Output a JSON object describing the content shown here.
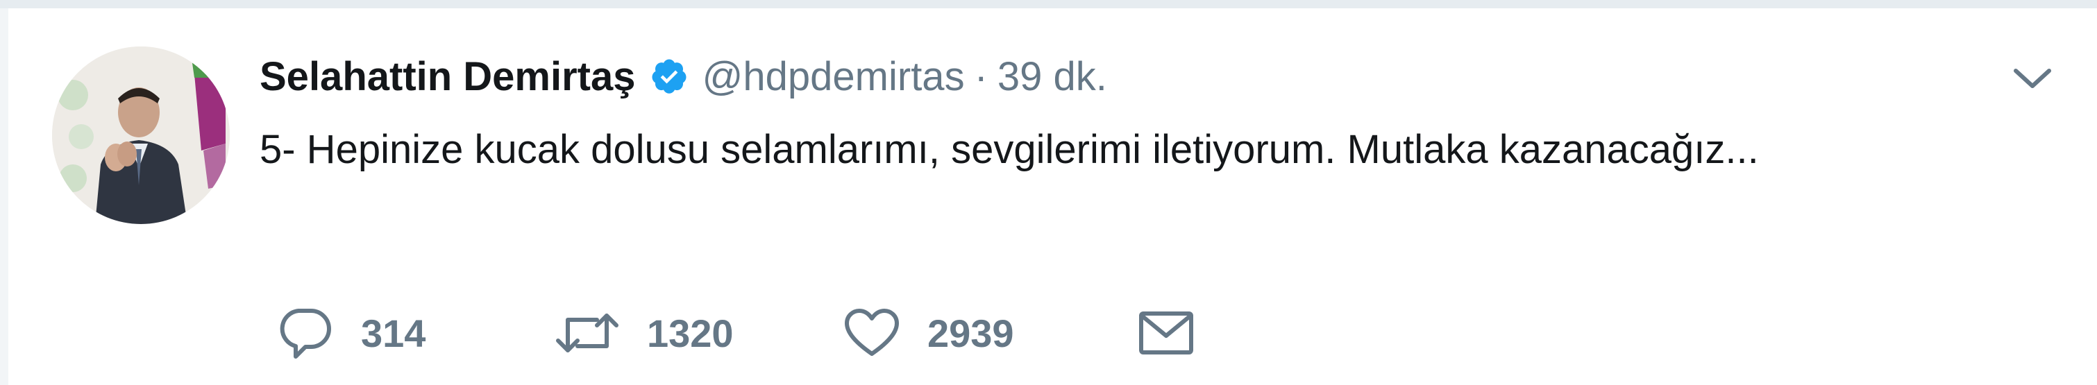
{
  "tweet": {
    "author": {
      "display_name": "Selahattin Demirtaş",
      "handle": "@hdpdemirtas"
    },
    "separator": "·",
    "timestamp": "39 dk.",
    "text": "5- Hepinize kucak dolusu selamlarımı, sevgilerimi iletiyorum. Mutlaka kazanacağız..."
  },
  "actions": {
    "reply_count": "314",
    "retweet_count": "1320",
    "like_count": "2939"
  },
  "icons": {
    "verified": "verified-badge-icon",
    "caret": "chevron-down-icon",
    "reply": "reply-icon",
    "retweet": "retweet-icon",
    "like": "heart-icon",
    "dm": "envelope-icon"
  },
  "colors": {
    "text_primary": "#14171a",
    "text_secondary": "#657786",
    "verified_blue": "#1da1f2",
    "border": "#e6ecf0"
  }
}
